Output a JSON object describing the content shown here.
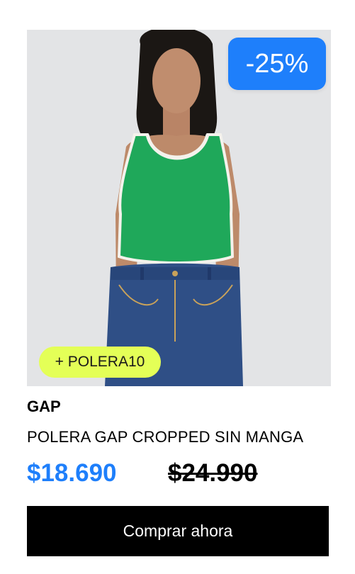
{
  "product": {
    "brand": "GAP",
    "name": "POLERA GAP CROPPED SIN MANGA",
    "price_current": "$18.690",
    "price_original": "$24.990",
    "discount_badge": "-25%",
    "promo_tag": "+ POLERA10",
    "buy_label": "Comprar ahora"
  },
  "colors": {
    "accent_blue": "#1e7ffb",
    "promo_yellow": "#e4ff57",
    "button_black": "#000000",
    "image_bg": "#e3e4e6",
    "top_green": "#1fa85a",
    "denim": "#2f4f86"
  }
}
